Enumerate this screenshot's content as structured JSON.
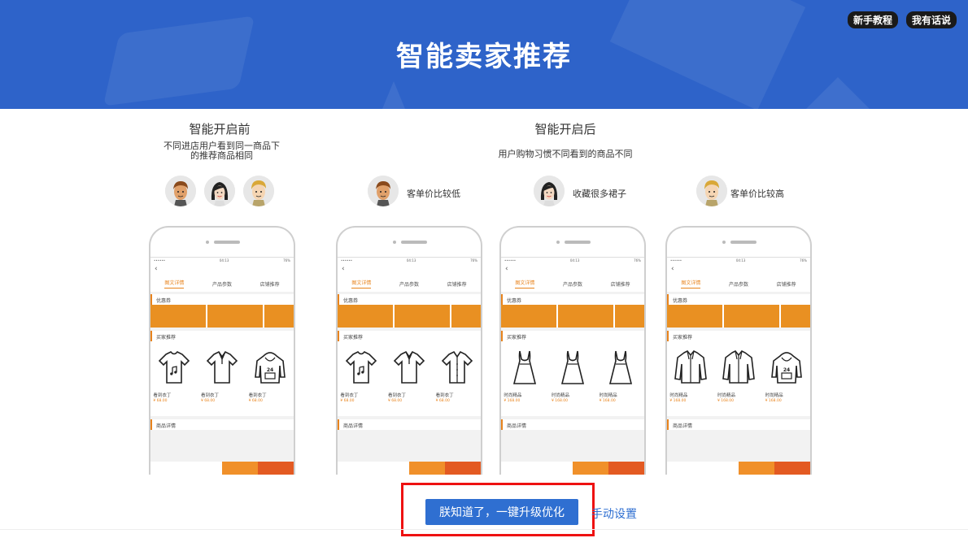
{
  "banner": {
    "title": "智能卖家推荐"
  },
  "top_links": {
    "tutorial": "新手教程",
    "feedback": "我有话说"
  },
  "before": {
    "title": "智能开启前",
    "desc_line1": "不同进店用户看到同一商品下",
    "desc_line2": "的推荐商品相同"
  },
  "after": {
    "title": "智能开启后",
    "desc": "用户购物习惯不同看到的商品不同",
    "personas": [
      {
        "label": "客单价比较低"
      },
      {
        "label": "收藏很多裙子"
      },
      {
        "label": "客单价比较高"
      }
    ]
  },
  "phone": {
    "status_left": "••••••",
    "status_mid": "04:13",
    "status_right": "76%",
    "back": "‹",
    "tabs": [
      "图文详情",
      "产品参数",
      "店铺推荐"
    ],
    "coupon_label": "优惠券",
    "recommend_label": "买家推荐",
    "detail_label": "商品详情"
  },
  "phones": [
    {
      "products": [
        {
          "name": "看到衣丁",
          "price": "¥ 68.00",
          "icon": "tshirt-icon"
        },
        {
          "name": "看到衣丁",
          "price": "¥ 68.00",
          "icon": "polo-icon"
        },
        {
          "name": "看到衣丁",
          "price": "¥ 68.00",
          "icon": "hoodie-icon"
        }
      ]
    },
    {
      "products": [
        {
          "name": "看到衣丁",
          "price": "¥ 68.00",
          "icon": "tshirt-icon"
        },
        {
          "name": "看到衣丁",
          "price": "¥ 68.00",
          "icon": "polo-icon"
        },
        {
          "name": "看到衣丁",
          "price": "¥ 68.00",
          "icon": "shirt-icon"
        }
      ]
    },
    {
      "products": [
        {
          "name": "时尚精品",
          "price": "¥ 168.00",
          "icon": "dress-icon"
        },
        {
          "name": "时尚精品",
          "price": "¥ 168.00",
          "icon": "dress-icon"
        },
        {
          "name": "时尚精品",
          "price": "¥ 168.00",
          "icon": "dress-icon"
        }
      ]
    },
    {
      "products": [
        {
          "name": "时尚精品",
          "price": "¥ 168.00",
          "icon": "jacket-icon"
        },
        {
          "name": "时尚精品",
          "price": "¥ 168.00",
          "icon": "jacket-icon"
        },
        {
          "name": "时尚精品",
          "price": "¥ 168.00",
          "icon": "hoodie-icon"
        }
      ]
    }
  ],
  "actions": {
    "upgrade": "朕知道了，一键升级优化",
    "manual": "手动设置"
  },
  "colors": {
    "banner": "#2e63c9",
    "accent": "#e99022",
    "button": "#2f6fd1",
    "highlight": "#ee1111"
  }
}
